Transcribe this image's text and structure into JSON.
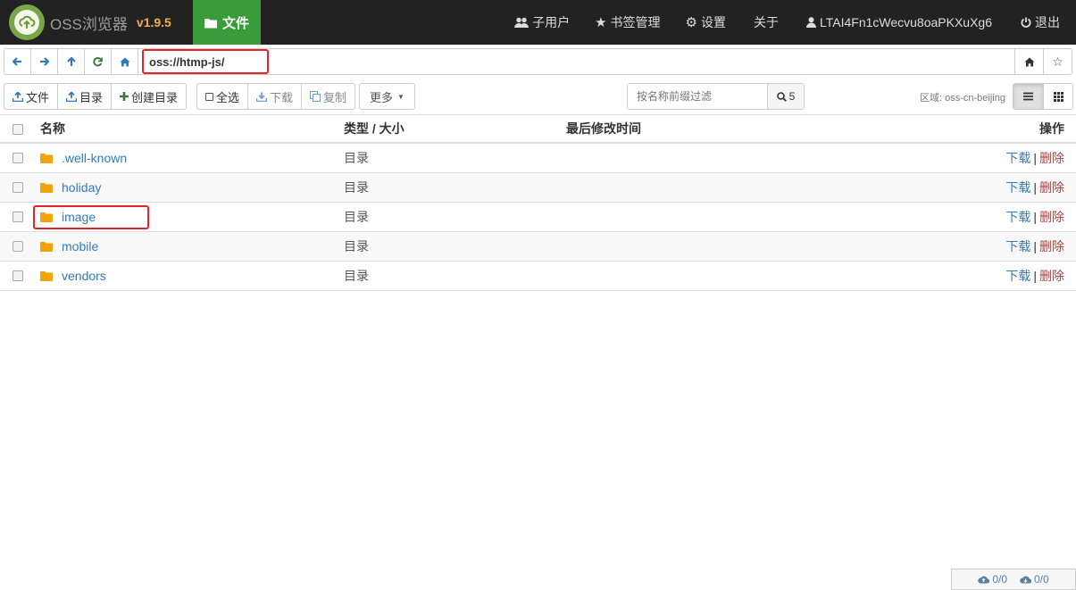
{
  "app": {
    "name": "OSS浏览器",
    "version": "v1.9.5"
  },
  "nav": {
    "files_label": "文件",
    "subusers_label": "子用户",
    "bookmarks_label": "书签管理",
    "settings_label": "设置",
    "about_label": "关于",
    "account_label": "LTAI4Fn1cWecvu8oaPKXuXg6",
    "logout_label": "退出"
  },
  "address": {
    "path": "oss://htmp-js/"
  },
  "toolbar": {
    "upload_file_label": "文件",
    "upload_dir_label": "目录",
    "create_dir_label": "创建目录",
    "select_all_label": "全选",
    "download_label": "下载",
    "copy_label": "复制",
    "more_label": "更多",
    "search_placeholder": "按名称前缀过滤",
    "search_count": "5",
    "region_label": "区域: oss-cn-beijing"
  },
  "table": {
    "headers": {
      "name": "名称",
      "type_size": "类型 / 大小",
      "modified": "最后修改时间",
      "actions": "操作"
    },
    "rows": [
      {
        "name": ".well-known",
        "type": "目录",
        "download": "下载",
        "sep": "|",
        "delete": "删除"
      },
      {
        "name": "holiday",
        "type": "目录",
        "download": "下载",
        "sep": "|",
        "delete": "删除"
      },
      {
        "name": "image",
        "type": "目录",
        "download": "下载",
        "sep": "|",
        "delete": "删除"
      },
      {
        "name": "mobile",
        "type": "目录",
        "download": "下载",
        "sep": "|",
        "delete": "删除"
      },
      {
        "name": "vendors",
        "type": "目录",
        "download": "下载",
        "sep": "|",
        "delete": "删除"
      }
    ]
  },
  "status": {
    "upload": "0/0",
    "download": "0/0"
  },
  "colors": {
    "navbar": "#222222",
    "active_tab": "#3a9b3a",
    "link": "#337ab7",
    "delete": "#a94442",
    "folder": "#f0a30a",
    "highlight": "#e0262b"
  },
  "icons": {
    "logo": "cloud-upload-logo",
    "folder": "folder-icon"
  }
}
